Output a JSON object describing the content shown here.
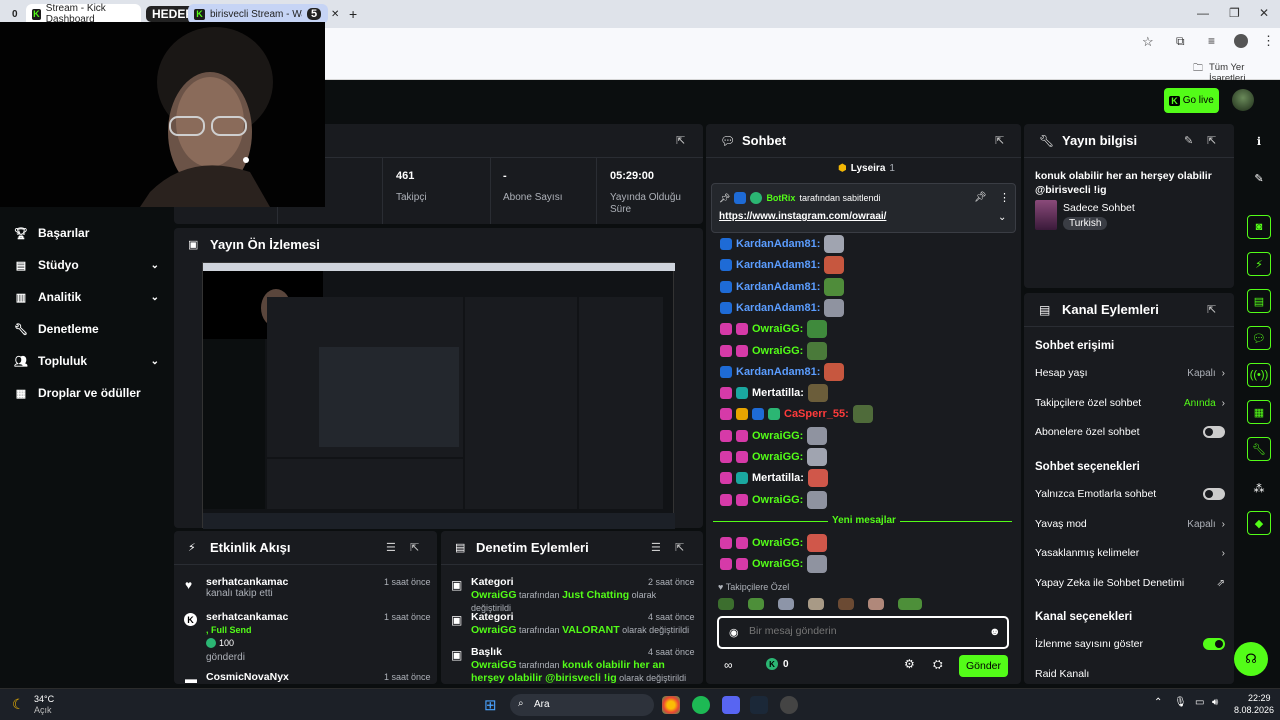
{
  "browser": {
    "tab_group_count": "0",
    "tab1_title": "Stream - Kick Dashboard",
    "group_label": "HEDEF",
    "tab2_title": "birisvecli Stream - Watch L",
    "tab2_count": "5",
    "new_tab": "+",
    "bookmarks_folder": "Tüm Yer İşaretleri"
  },
  "header": {
    "go_live": "Go live"
  },
  "sidebar": {
    "items": [
      {
        "label": "Başarılar",
        "icon": "trophy-icon",
        "chevron": false
      },
      {
        "label": "Stüdyo",
        "icon": "studio-icon",
        "chevron": true
      },
      {
        "label": "Analitik",
        "icon": "analytics-icon",
        "chevron": true
      },
      {
        "label": "Denetleme",
        "icon": "wrench-icon",
        "chevron": false
      },
      {
        "label": "Topluluk",
        "icon": "community-icon",
        "chevron": true
      },
      {
        "label": "Droplar ve ödüller",
        "icon": "drops-icon",
        "chevron": false
      }
    ]
  },
  "stats": [
    {
      "value": "461",
      "label": "Takipçi"
    },
    {
      "value": "-",
      "label": "Abone Sayısı"
    },
    {
      "value": "05:29:00",
      "label": "Yayında Olduğu Süre"
    }
  ],
  "preview": {
    "title": "Yayın Ön İzlemesi"
  },
  "chat": {
    "title": "Sohbet",
    "top_gifter": "Lyseira",
    "top_gifter_count": "1",
    "pinned_by": "BotRix",
    "pinned_suffix": "tarafından sabitlendi",
    "pinned_link": "https://www.instagram.com/owraai/",
    "messages": [
      {
        "user": "KardanAdam81:",
        "color": "#5b9dff",
        "badges": [
          "#1e6bd6"
        ]
      },
      {
        "user": "KardanAdam81:",
        "color": "#5b9dff",
        "badges": [
          "#1e6bd6"
        ]
      },
      {
        "user": "KardanAdam81:",
        "color": "#5b9dff",
        "badges": [
          "#1e6bd6"
        ]
      },
      {
        "user": "KardanAdam81:",
        "color": "#5b9dff",
        "badges": [
          "#1e6bd6"
        ]
      },
      {
        "user": "OwraiGG:",
        "color": "#53fc18",
        "badges": [
          "#d63aa8",
          "#d63aa8"
        ]
      },
      {
        "user": "OwraiGG:",
        "color": "#53fc18",
        "badges": [
          "#d63aa8",
          "#d63aa8"
        ]
      },
      {
        "user": "KardanAdam81:",
        "color": "#5b9dff",
        "badges": [
          "#1e6bd6"
        ]
      },
      {
        "user": "Mertatilla:",
        "color": "#ffffff",
        "badges": [
          "#d63aa8",
          "#1aa8a0"
        ]
      },
      {
        "user": "CaSperr_55:",
        "color": "#ff3b3b",
        "badges": [
          "#d63aa8",
          "#e8a400",
          "#1e6bd6",
          "#2bb673"
        ]
      },
      {
        "user": "OwraiGG:",
        "color": "#53fc18",
        "badges": [
          "#d63aa8",
          "#d63aa8"
        ]
      },
      {
        "user": "OwraiGG:",
        "color": "#53fc18",
        "badges": [
          "#d63aa8",
          "#d63aa8"
        ]
      },
      {
        "user": "Mertatilla:",
        "color": "#ffffff",
        "badges": [
          "#d63aa8",
          "#1aa8a0"
        ]
      },
      {
        "user": "OwraiGG:",
        "color": "#53fc18",
        "badges": [
          "#d63aa8",
          "#d63aa8"
        ]
      }
    ],
    "new_messages": "Yeni mesajlar",
    "messages_after": [
      {
        "user": "OwraiGG:",
        "color": "#53fc18",
        "badges": [
          "#d63aa8",
          "#d63aa8"
        ]
      },
      {
        "user": "OwraiGG:",
        "color": "#53fc18",
        "badges": [
          "#d63aa8",
          "#d63aa8"
        ]
      }
    ],
    "followers_only": "Takipçilere Özel",
    "input_placeholder": "Bir mesaj gönderin",
    "points": "0",
    "send": "Gönder"
  },
  "stream_info": {
    "title": "Yayın bilgisi",
    "stream_title": "konuk olabilir her an herşey olabilir @birisvecli !ig",
    "category": "Sadece Sohbet",
    "language": "Turkish"
  },
  "channel_actions": {
    "title": "Kanal Eylemleri",
    "chat_access": "Sohbet erişimi",
    "account_age": "Hesap yaşı",
    "account_age_val": "Kapalı",
    "followers_only": "Takipçilere özel sohbet",
    "followers_only_val": "Anında",
    "subs_only": "Abonelere özel sohbet",
    "chat_options": "Sohbet seçenekleri",
    "emote_only": "Yalnızca Emotlarla sohbet",
    "slow_mode": "Yavaş mod",
    "slow_mode_val": "Kapalı",
    "banned_words": "Yasaklanmış kelimeler",
    "ai_moderation": "Yapay Zeka ile Sohbet Denetimi",
    "channel_options": "Kanal seçenekleri",
    "show_viewers": "İzlenme sayısını göster",
    "raid": "Raid Kanalı"
  },
  "activity": {
    "title": "Etkinlik Akışı",
    "items": [
      {
        "user": "serhatcankamac",
        "text": "kanalı takip etti",
        "time": "1 saat önce"
      },
      {
        "user": "serhatcankamac",
        "highlight": ", Full Send",
        "amount": "100",
        "text": "gönderdi",
        "time": "1 saat önce"
      },
      {
        "user": "CosmicNovaNyx",
        "time": "1 saat önce"
      }
    ]
  },
  "mod_actions": {
    "title": "Denetim Eylemleri",
    "items": [
      {
        "heading": "Kategori",
        "time": "2 saat önce",
        "actor": "OwraiGG",
        "mid": " tarafından ",
        "value": "Just Chatting",
        "end": " olarak değiştirildi"
      },
      {
        "heading": "Kategori",
        "time": "4 saat önce",
        "actor": "OwraiGG",
        "mid": " tarafından ",
        "value": "VALORANT",
        "end": " olarak değiştirildi"
      },
      {
        "heading": "Başlık",
        "time": "4 saat önce",
        "actor": "OwraiGG",
        "mid": " tarafından ",
        "value": "konuk olabilir her an herşey olabilir @birisvecli !ig",
        "end": " olarak değiştirildi"
      }
    ]
  },
  "taskbar": {
    "weather_temp": "34°C",
    "weather_desc": "Açık",
    "search": "Ara",
    "time": "22:29",
    "date": "8.08.2026"
  }
}
